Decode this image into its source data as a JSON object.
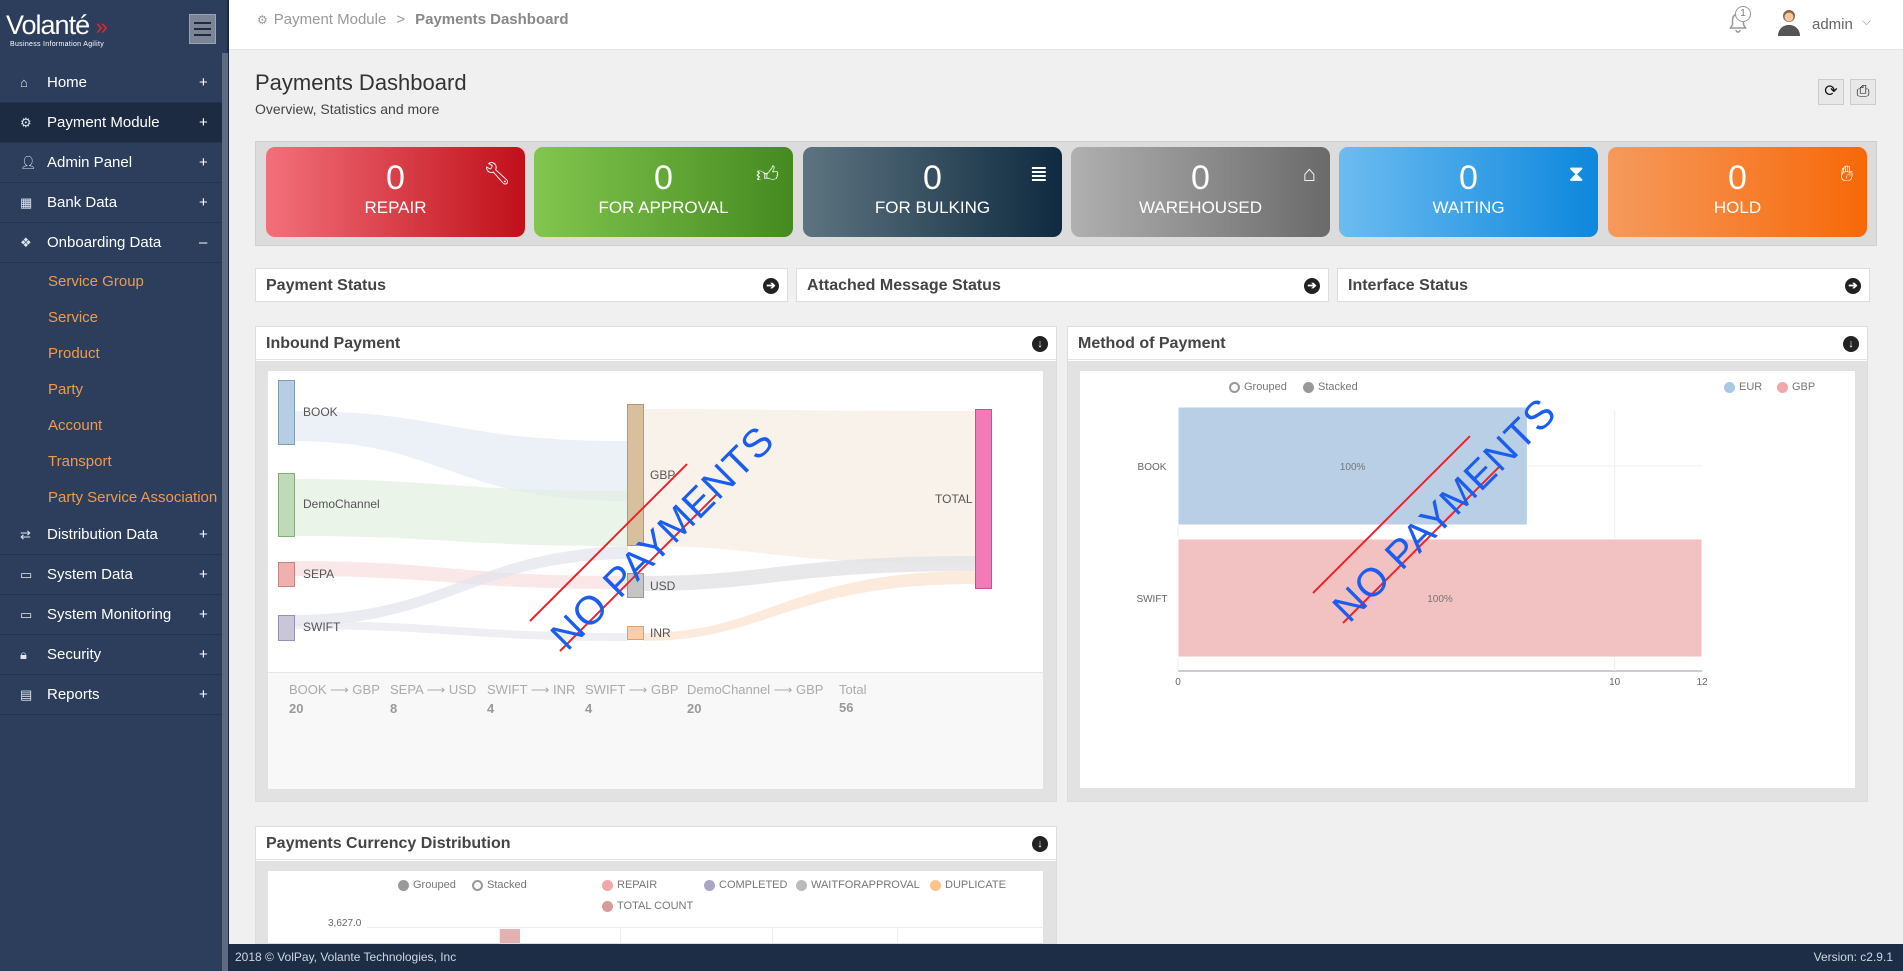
{
  "app": {
    "brand": "Volanté",
    "tagline": "Business Information Agility"
  },
  "sidebar": {
    "items": [
      {
        "label": "Home",
        "toggle": "+"
      },
      {
        "label": "Payment Module",
        "toggle": "+"
      },
      {
        "label": "Admin Panel",
        "toggle": "+"
      },
      {
        "label": "Bank Data",
        "toggle": "+"
      },
      {
        "label": "Onboarding Data",
        "toggle": "–"
      },
      {
        "label": "Distribution Data",
        "toggle": "+"
      },
      {
        "label": "System Data",
        "toggle": "+"
      },
      {
        "label": "System Monitoring",
        "toggle": "+"
      },
      {
        "label": "Security",
        "toggle": "+"
      },
      {
        "label": "Reports",
        "toggle": "+"
      }
    ],
    "subitems": [
      "Service Group",
      "Service",
      "Product",
      "Party",
      "Account",
      "Transport",
      "Party Service Association"
    ]
  },
  "topbar": {
    "crumb_root": "Payment Module",
    "crumb_sep": ">",
    "crumb_current": "Payments Dashboard",
    "notif_count": "1",
    "user": "admin"
  },
  "page": {
    "title": "Payments Dashboard",
    "subtitle": "Overview, Statistics and more"
  },
  "cards": [
    {
      "value": "0",
      "label": "REPAIR",
      "color_from": "#f2707a",
      "color_to": "#c0101a",
      "icon": "wrench-icon"
    },
    {
      "value": "0",
      "label": "FOR APPROVAL",
      "color_from": "#82c64e",
      "color_to": "#458a20",
      "icon": "thumbs-up-icon"
    },
    {
      "value": "0",
      "label": "FOR BULKING",
      "color_from": "#5d7480",
      "color_to": "#0f2a40",
      "icon": "stack-icon"
    },
    {
      "value": "0",
      "label": "WAREHOUSED",
      "color_from": "#b0b0b0",
      "color_to": "#6a6a6a",
      "icon": "home-icon"
    },
    {
      "value": "0",
      "label": "WAITING",
      "color_from": "#6cbcf0",
      "color_to": "#0d87dd",
      "icon": "hourglass-icon"
    },
    {
      "value": "0",
      "label": "HOLD",
      "color_from": "#f59a5c",
      "color_to": "#f76808",
      "icon": "hand-icon"
    }
  ],
  "status_panels": [
    "Payment Status",
    "Attached Message Status",
    "Interface Status"
  ],
  "inbound": {
    "title": "Inbound Payment",
    "sources": [
      "BOOK",
      "DemoChannel",
      "SEPA",
      "SWIFT"
    ],
    "currencies": [
      "GBP",
      "USD",
      "INR"
    ],
    "total_label": "TOTAL",
    "stamp": "NO PAYMENTS",
    "stats": [
      {
        "label": "BOOK ⟶ GBP",
        "value": "20"
      },
      {
        "label": "SEPA ⟶ USD",
        "value": "8"
      },
      {
        "label": "SWIFT ⟶ INR",
        "value": "4"
      },
      {
        "label": "SWIFT ⟶ GBP",
        "value": "4"
      },
      {
        "label": "DemoChannel ⟶ GBP",
        "value": "20"
      },
      {
        "label": "Total",
        "value": "56"
      }
    ]
  },
  "method": {
    "title": "Method of Payment",
    "stamp": "NO PAYMENTS",
    "legend": {
      "grouped": "Grouped",
      "stacked": "Stacked",
      "eur": "EUR",
      "gbp": "GBP"
    }
  },
  "currency": {
    "title": "Payments Currency Distribution",
    "legend": {
      "grouped": "Grouped",
      "stacked": "Stacked",
      "repair": "REPAIR",
      "completed": "COMPLETED",
      "waiting": "WAITFORAPPROVAL",
      "duplicate": "DUPLICATE",
      "total": "TOTAL COUNT"
    },
    "top_tick": "3,627.0"
  },
  "chart_data": {
    "type": "bar",
    "orientation": "horizontal",
    "categories": [
      "BOOK",
      "SWIFT"
    ],
    "series": [
      {
        "name": "EUR",
        "values": [
          8,
          0
        ],
        "color": "#b8cfe6"
      },
      {
        "name": "GBP",
        "values": [
          0,
          12
        ],
        "color": "#f2c1c1"
      }
    ],
    "data_labels": [
      "100%",
      "100%"
    ],
    "xticks": [
      "0",
      "10",
      "12"
    ],
    "xlim": [
      0,
      12
    ]
  },
  "footer": {
    "copyright": "2018 © VolPay, Volante Technologies, Inc",
    "version": "Version: c2.9.1"
  }
}
